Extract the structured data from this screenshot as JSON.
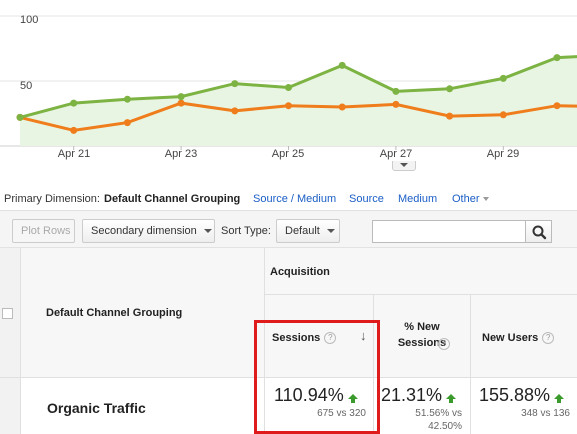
{
  "chart": {
    "y_labels": [
      "100",
      "50"
    ],
    "x_labels": [
      "Apr 21",
      "Apr 23",
      "Apr 25",
      "Apr 27",
      "Apr 29"
    ],
    "colors": {
      "sessions_line": "#7cb342",
      "sessions_fill": "#e8f5e2",
      "compare_line": "#ef7d1b",
      "grid": "#e6e6e6"
    },
    "chart_data": {
      "type": "line",
      "x": [
        "Apr 20",
        "Apr 21",
        "Apr 22",
        "Apr 23",
        "Apr 24",
        "Apr 25",
        "Apr 26",
        "Apr 27",
        "Apr 28",
        "Apr 29",
        "Apr 30",
        "May 1"
      ],
      "ylim": [
        0,
        100
      ],
      "grid": true,
      "series": [
        {
          "values": [
            22,
            33,
            36,
            38,
            48,
            45,
            62,
            42,
            44,
            52,
            68,
            70
          ]
        },
        {
          "values": [
            22,
            12,
            18,
            33,
            27,
            31,
            30,
            32,
            23,
            24,
            31,
            30
          ]
        }
      ]
    }
  },
  "dimension_bar": {
    "label": "Primary Dimension:",
    "active": "Default Channel Grouping",
    "links": [
      "Source / Medium",
      "Source",
      "Medium",
      "Other"
    ]
  },
  "toolbar": {
    "plot_rows": "Plot Rows",
    "secondary_dimension": "Secondary dimension",
    "sort_type_label": "Sort Type:",
    "sort_type_value": "Default",
    "search_value": ""
  },
  "table": {
    "group_header": "Acquisition",
    "dimension_header": "Default Channel Grouping",
    "columns": [
      {
        "label": "Sessions",
        "pct": "110.94%",
        "compare": "675 vs 320"
      },
      {
        "label": "% New Sessions",
        "pct": "21.31%",
        "compare": "51.56% vs 42.50%"
      },
      {
        "label": "New Users",
        "pct": "155.88%",
        "compare": "348 vs 136"
      }
    ],
    "help_glyph": "?",
    "row_label": "Organic Traffic"
  }
}
